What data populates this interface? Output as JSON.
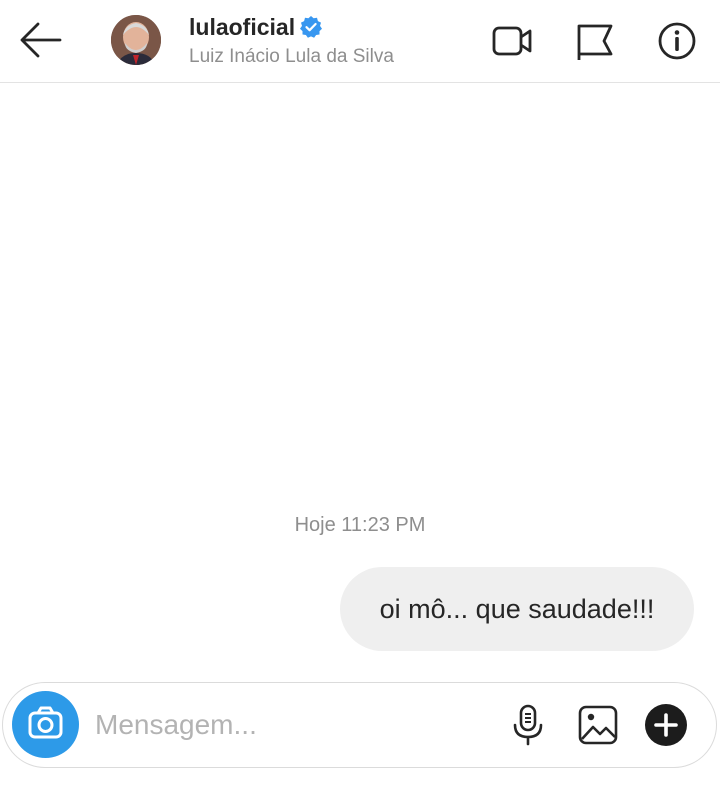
{
  "header": {
    "back_icon": "arrow-left-icon",
    "username": "lulaoficial",
    "verified_icon": "verified-badge-icon",
    "full_name": "Luiz Inácio Lula da Silva",
    "actions": [
      "video-call-icon",
      "flag-icon",
      "info-icon"
    ]
  },
  "thread": {
    "timestamp": "Hoje 11:23 PM",
    "messages": [
      {
        "from": "me",
        "text": "oi mô... que saudade!!!"
      }
    ]
  },
  "composer": {
    "placeholder": "Mensagem...",
    "icons": [
      "camera-icon",
      "microphone-icon",
      "gallery-icon",
      "plus-icon"
    ]
  },
  "colors": {
    "accent": "#3897f0",
    "camera_button": "#2d9ae8",
    "bubble": "#efefef",
    "secondary_text": "#8e8e8e"
  }
}
